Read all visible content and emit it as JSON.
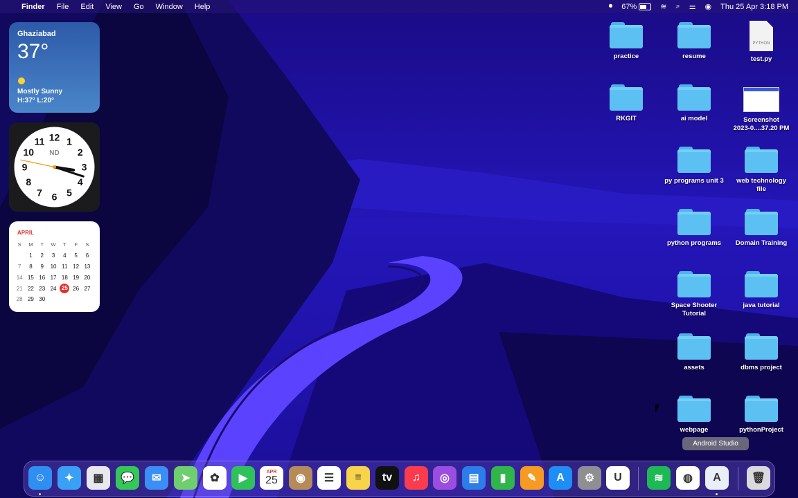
{
  "menubar": {
    "app_name": "Finder",
    "menus": [
      "File",
      "Edit",
      "View",
      "Go",
      "Window",
      "Help"
    ],
    "battery_percent": "67%",
    "datetime": "Thu 25 Apr  3:18 PM"
  },
  "weather": {
    "city": "Ghaziabad",
    "temperature": "37°",
    "condition": "Mostly Sunny",
    "high_low": "H:37° L:20°"
  },
  "clock": {
    "label": "ND",
    "numbers": [
      "12",
      "1",
      "2",
      "3",
      "4",
      "5",
      "6",
      "7",
      "8",
      "9",
      "10",
      "11"
    ],
    "hour": 3,
    "minute": 18,
    "second": 47
  },
  "calendar": {
    "month": "APRIL",
    "weekdays": [
      "S",
      "M",
      "T",
      "W",
      "T",
      "F",
      "S"
    ],
    "weeks": [
      [
        "",
        "1",
        "2",
        "3",
        "4",
        "5",
        "6"
      ],
      [
        "7",
        "8",
        "9",
        "10",
        "11",
        "12",
        "13"
      ],
      [
        "14",
        "15",
        "16",
        "17",
        "18",
        "19",
        "20"
      ],
      [
        "21",
        "22",
        "23",
        "24",
        "25",
        "26",
        "27"
      ],
      [
        "28",
        "29",
        "30",
        "",
        "",
        "",
        ""
      ]
    ],
    "today": "25"
  },
  "desktop_icons": [
    {
      "label": "practice",
      "type": "folder"
    },
    {
      "label": "resume",
      "type": "folder"
    },
    {
      "label": "test.py",
      "type": "pyfile",
      "badge": "PYTHON"
    },
    {
      "label": "RKGIT",
      "type": "folder"
    },
    {
      "label": "ai model",
      "type": "folder"
    },
    {
      "label": "Screenshot\n2023-0....37.20 PM",
      "type": "screenshot"
    },
    {
      "label": "py programs unit 3",
      "type": "folder"
    },
    {
      "label": "web technology\nfile",
      "type": "folder"
    },
    {
      "label": "python programs",
      "type": "folder"
    },
    {
      "label": "Domain Training",
      "type": "folder"
    },
    {
      "label": "Space Shooter\nTutorial",
      "type": "folder"
    },
    {
      "label": "java tutorial",
      "type": "folder"
    },
    {
      "label": "assets",
      "type": "folder"
    },
    {
      "label": "dbms project",
      "type": "folder"
    },
    {
      "label": "webpage",
      "type": "folder"
    },
    {
      "label": "pythonProject",
      "type": "folder"
    }
  ],
  "tooltip": "Android Studio",
  "dock": {
    "items": [
      {
        "name": "finder-icon",
        "color": "#2f8ff0",
        "glyph": "☺",
        "running": true
      },
      {
        "name": "safari-icon",
        "color": "#3aa0f5",
        "glyph": "✦",
        "running": false
      },
      {
        "name": "launchpad-icon",
        "color": "#e8e8ee",
        "glyph": "▦",
        "running": false
      },
      {
        "name": "messages-icon",
        "color": "#34c759",
        "glyph": "💬",
        "running": false
      },
      {
        "name": "mail-icon",
        "color": "#3a8ef5",
        "glyph": "✉",
        "running": false
      },
      {
        "name": "maps-icon",
        "color": "#6fcf6f",
        "glyph": "➤",
        "running": false
      },
      {
        "name": "photos-icon",
        "color": "#ffffff",
        "glyph": "✿",
        "running": false
      },
      {
        "name": "facetime-icon",
        "color": "#2fc25b",
        "glyph": "▶",
        "running": false
      },
      {
        "name": "calendar-icon",
        "color": "#ffffff",
        "glyph": "25",
        "month": "APR",
        "running": false
      },
      {
        "name": "contacts-icon",
        "color": "#b58b5a",
        "glyph": "◉",
        "running": false
      },
      {
        "name": "reminders-icon",
        "color": "#ffffff",
        "glyph": "☰",
        "running": false
      },
      {
        "name": "notes-icon",
        "color": "#f7d44a",
        "glyph": "≡",
        "running": false
      },
      {
        "name": "tv-icon",
        "color": "#111111",
        "glyph": "tv",
        "running": false
      },
      {
        "name": "music-icon",
        "color": "#fa3c4c",
        "glyph": "♫",
        "running": false
      },
      {
        "name": "podcasts-icon",
        "color": "#9b4de0",
        "glyph": "◎",
        "running": false
      },
      {
        "name": "keynote-icon",
        "color": "#2b7de9",
        "glyph": "▤",
        "running": false
      },
      {
        "name": "numbers-icon",
        "color": "#2fb54a",
        "glyph": "▮",
        "running": false
      },
      {
        "name": "pages-icon",
        "color": "#f59a23",
        "glyph": "✎",
        "running": false
      },
      {
        "name": "app-store-icon",
        "color": "#1e8ef5",
        "glyph": "A",
        "running": false
      },
      {
        "name": "system-settings-icon",
        "color": "#8e8e93",
        "glyph": "⚙",
        "running": false
      },
      {
        "name": "udemy-icon",
        "color": "#ffffff",
        "glyph": "U",
        "running": false
      },
      {
        "name": "spotify-icon",
        "color": "#1db954",
        "glyph": "≋",
        "running": false
      },
      {
        "name": "chrome-icon",
        "color": "#ffffff",
        "glyph": "◍",
        "running": false
      },
      {
        "name": "android-studio-icon",
        "color": "#e9eef7",
        "glyph": "A",
        "running": true
      },
      {
        "name": "trash-icon",
        "color": "#d9d9de",
        "glyph": "🗑",
        "running": false
      }
    ]
  }
}
